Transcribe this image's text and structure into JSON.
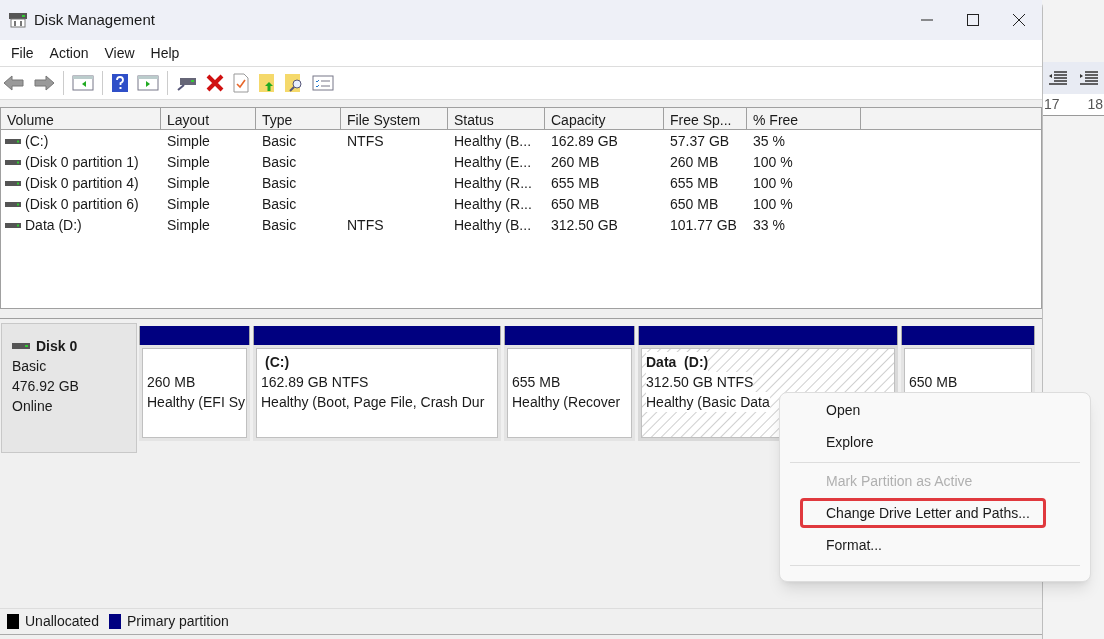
{
  "window": {
    "title": "Disk Management"
  },
  "menu_bar": [
    "File",
    "Action",
    "View",
    "Help"
  ],
  "volume_table": {
    "columns": [
      "Volume",
      "Layout",
      "Type",
      "File System",
      "Status",
      "Capacity",
      "Free Sp...",
      "% Free"
    ],
    "rows": [
      [
        "(C:)",
        "Simple",
        "Basic",
        "NTFS",
        "Healthy (B...",
        "162.89 GB",
        "57.37 GB",
        "35 %"
      ],
      [
        "(Disk 0 partition 1)",
        "Simple",
        "Basic",
        "",
        "Healthy (E...",
        "260 MB",
        "260 MB",
        "100 %"
      ],
      [
        "(Disk 0 partition 4)",
        "Simple",
        "Basic",
        "",
        "Healthy (R...",
        "655 MB",
        "655 MB",
        "100 %"
      ],
      [
        "(Disk 0 partition 6)",
        "Simple",
        "Basic",
        "",
        "Healthy (R...",
        "650 MB",
        "650 MB",
        "100 %"
      ],
      [
        "Data (D:)",
        "Simple",
        "Basic",
        "NTFS",
        "Healthy (B...",
        "312.50 GB",
        "101.77 GB",
        "33 %"
      ]
    ]
  },
  "disk": {
    "name": "Disk 0",
    "type": "Basic",
    "size": "476.92 GB",
    "state": "Online",
    "partitions": [
      {
        "size": "260 MB",
        "status": "Healthy (EFI Sy",
        "selected": false
      },
      {
        "label": "(C:)",
        "size": "162.89 GB NTFS",
        "status": "Healthy (Boot, Page File, Crash Dur",
        "selected": false
      },
      {
        "size": "655 MB",
        "status": "Healthy (Recover",
        "selected": false
      },
      {
        "label": "Data  (D:)",
        "size": "312.50 GB NTFS",
        "status": "Healthy (Basic Data",
        "selected": true
      },
      {
        "size": "650 MB",
        "selected": false
      }
    ]
  },
  "context_menu": [
    {
      "kind": "item",
      "label": "Open",
      "disabled": false,
      "highlighted": false
    },
    {
      "kind": "item",
      "label": "Explore",
      "disabled": false,
      "highlighted": false
    },
    {
      "kind": "separator"
    },
    {
      "kind": "item",
      "label": "Mark Partition as Active",
      "disabled": true,
      "highlighted": false
    },
    {
      "kind": "item",
      "label": "Change Drive Letter and Paths...",
      "disabled": false,
      "highlighted": true
    },
    {
      "kind": "item",
      "label": "Format...",
      "disabled": false,
      "highlighted": false
    },
    {
      "kind": "separator"
    }
  ],
  "legend": [
    {
      "label": "Unallocated",
      "color": "#000000"
    },
    {
      "label": "Primary partition",
      "color": "#000080"
    }
  ],
  "background_ruler": [
    "17",
    "18"
  ]
}
